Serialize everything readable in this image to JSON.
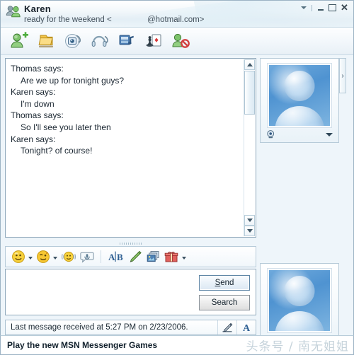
{
  "window": {
    "contact_name": "Karen",
    "status_message": "ready for the weekend <",
    "email": "@hotmail.com>",
    "contact_icon": "two-people-icon",
    "controls": {
      "menu_label": "chevron-down-icon",
      "minimize_label": "minimize-icon",
      "maximize_label": "maximize-icon",
      "close_label": "close-icon"
    }
  },
  "toolbar": {
    "items": [
      {
        "name": "invite-someone",
        "icon": "person-add-icon",
        "title": "Invite Someone to this Conversation"
      },
      {
        "name": "send-file",
        "icon": "folder-send-icon",
        "title": "Send a File or Photo"
      },
      {
        "name": "video-call",
        "icon": "webcam-icon",
        "title": "Start a Video Conversation"
      },
      {
        "name": "audio-call",
        "icon": "headset-icon",
        "title": "Start Talking"
      },
      {
        "name": "play-music",
        "icon": "music-note-icon",
        "title": "Music"
      },
      {
        "name": "play-game",
        "icon": "games-icon",
        "title": "Play a Game"
      },
      {
        "name": "block-contact",
        "icon": "person-block-icon",
        "title": "Block"
      }
    ]
  },
  "conversation": {
    "messages": [
      {
        "sender": "Thomas says:",
        "text": "Are we up for tonight guys?"
      },
      {
        "sender": "Karen says:",
        "text": "I'm down"
      },
      {
        "sender": "Thomas says:",
        "text": "So I'll see you later then"
      },
      {
        "sender": "Karen says:",
        "text": "Tonight? of course!"
      }
    ]
  },
  "format_bar": {
    "items": [
      {
        "name": "emoticons",
        "icon": "smiley-icon",
        "has_caret": true
      },
      {
        "name": "winks",
        "icon": "wink-icon",
        "has_caret": true
      },
      {
        "name": "nudge",
        "icon": "nudge-icon",
        "has_caret": false
      },
      {
        "name": "voice-clip",
        "icon": "voice-clip-icon",
        "has_caret": false
      },
      {
        "name": "change-font",
        "icon": "font-ab-icon",
        "has_caret": false
      },
      {
        "name": "handwriting",
        "icon": "pen-icon",
        "has_caret": false
      },
      {
        "name": "backgrounds",
        "icon": "backgrounds-icon",
        "has_caret": false
      },
      {
        "name": "send-gift",
        "icon": "gift-icon",
        "has_caret": true
      }
    ]
  },
  "input": {
    "value": "",
    "placeholder": ""
  },
  "buttons": {
    "send": {
      "prefix": "S",
      "rest": "end"
    },
    "search": "Search"
  },
  "statusbar": {
    "text": "Last message received at 5:27 PM on 2/23/2006.",
    "icons": [
      {
        "name": "handwriting-icon",
        "glyph": "pen"
      },
      {
        "name": "font-icon",
        "glyph": "A"
      }
    ]
  },
  "display_pictures": {
    "top": {
      "name": "contact-display-picture",
      "alt": "default-buddy-avatar",
      "webcam_icon": "webcam-icon",
      "caret": "chevron-down-icon"
    },
    "bottom": {
      "name": "self-display-picture",
      "alt": "default-buddy-avatar",
      "webcam_icon": "webcam-icon",
      "caret": "chevron-down-icon"
    },
    "expander": "›"
  },
  "adbar": {
    "text": "Play the new MSN Messenger Games",
    "watermark": "头条号 / 南无姐姐"
  },
  "colors": {
    "frame_border": "#9cb3c4",
    "titlebar_top": "#ffffff",
    "titlebar_bottom": "#e4eef5",
    "body_bg": "#eef5fa",
    "avatar_blue": "#4f93d1",
    "default_button_border": "#5f86a6"
  }
}
